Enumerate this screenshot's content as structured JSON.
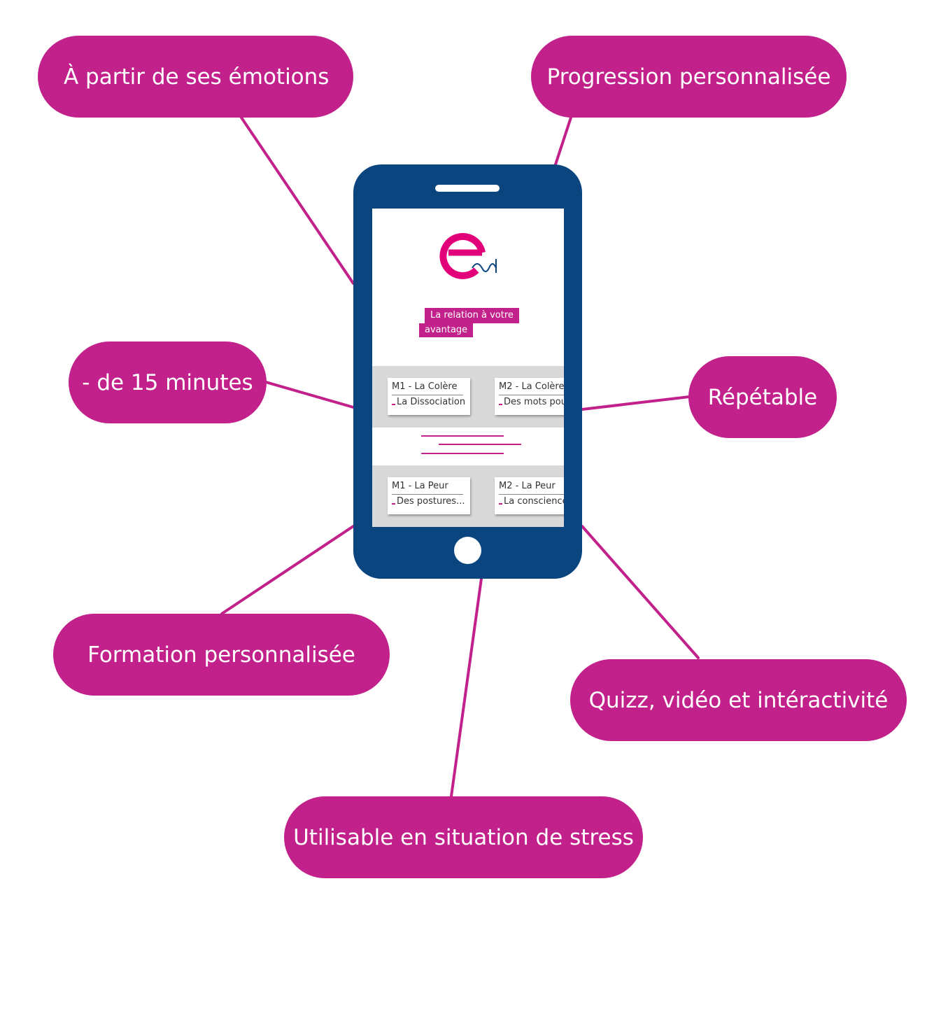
{
  "colors": {
    "accent": "#c2208a",
    "phone": "#0a4580",
    "card_band": "#d9d9d9"
  },
  "features": {
    "emotions": "À partir de ses émotions",
    "progression": "Progression personnalisée",
    "duration": "- de 15 minutes",
    "repeatable": "Répétable",
    "training": "Formation personnalisée",
    "quizz": "Quizz, vidéo et intéractivité",
    "stress": "Utilisable en situation de stress"
  },
  "phone_screen": {
    "logo_icon": "eo-logo-icon",
    "tagline_line1": "La relation à votre",
    "tagline_line2": "avantage",
    "modules_row1": [
      {
        "title": "M1 - La Colère",
        "subtitle": "La Dissociation"
      },
      {
        "title": "M2 - La Colère",
        "subtitle": "Des mots pou"
      }
    ],
    "modules_row2": [
      {
        "title": "M1 - La Peur",
        "subtitle": "Des postures..."
      },
      {
        "title": "M2 - La Peur",
        "subtitle": "La conscience"
      }
    ]
  }
}
